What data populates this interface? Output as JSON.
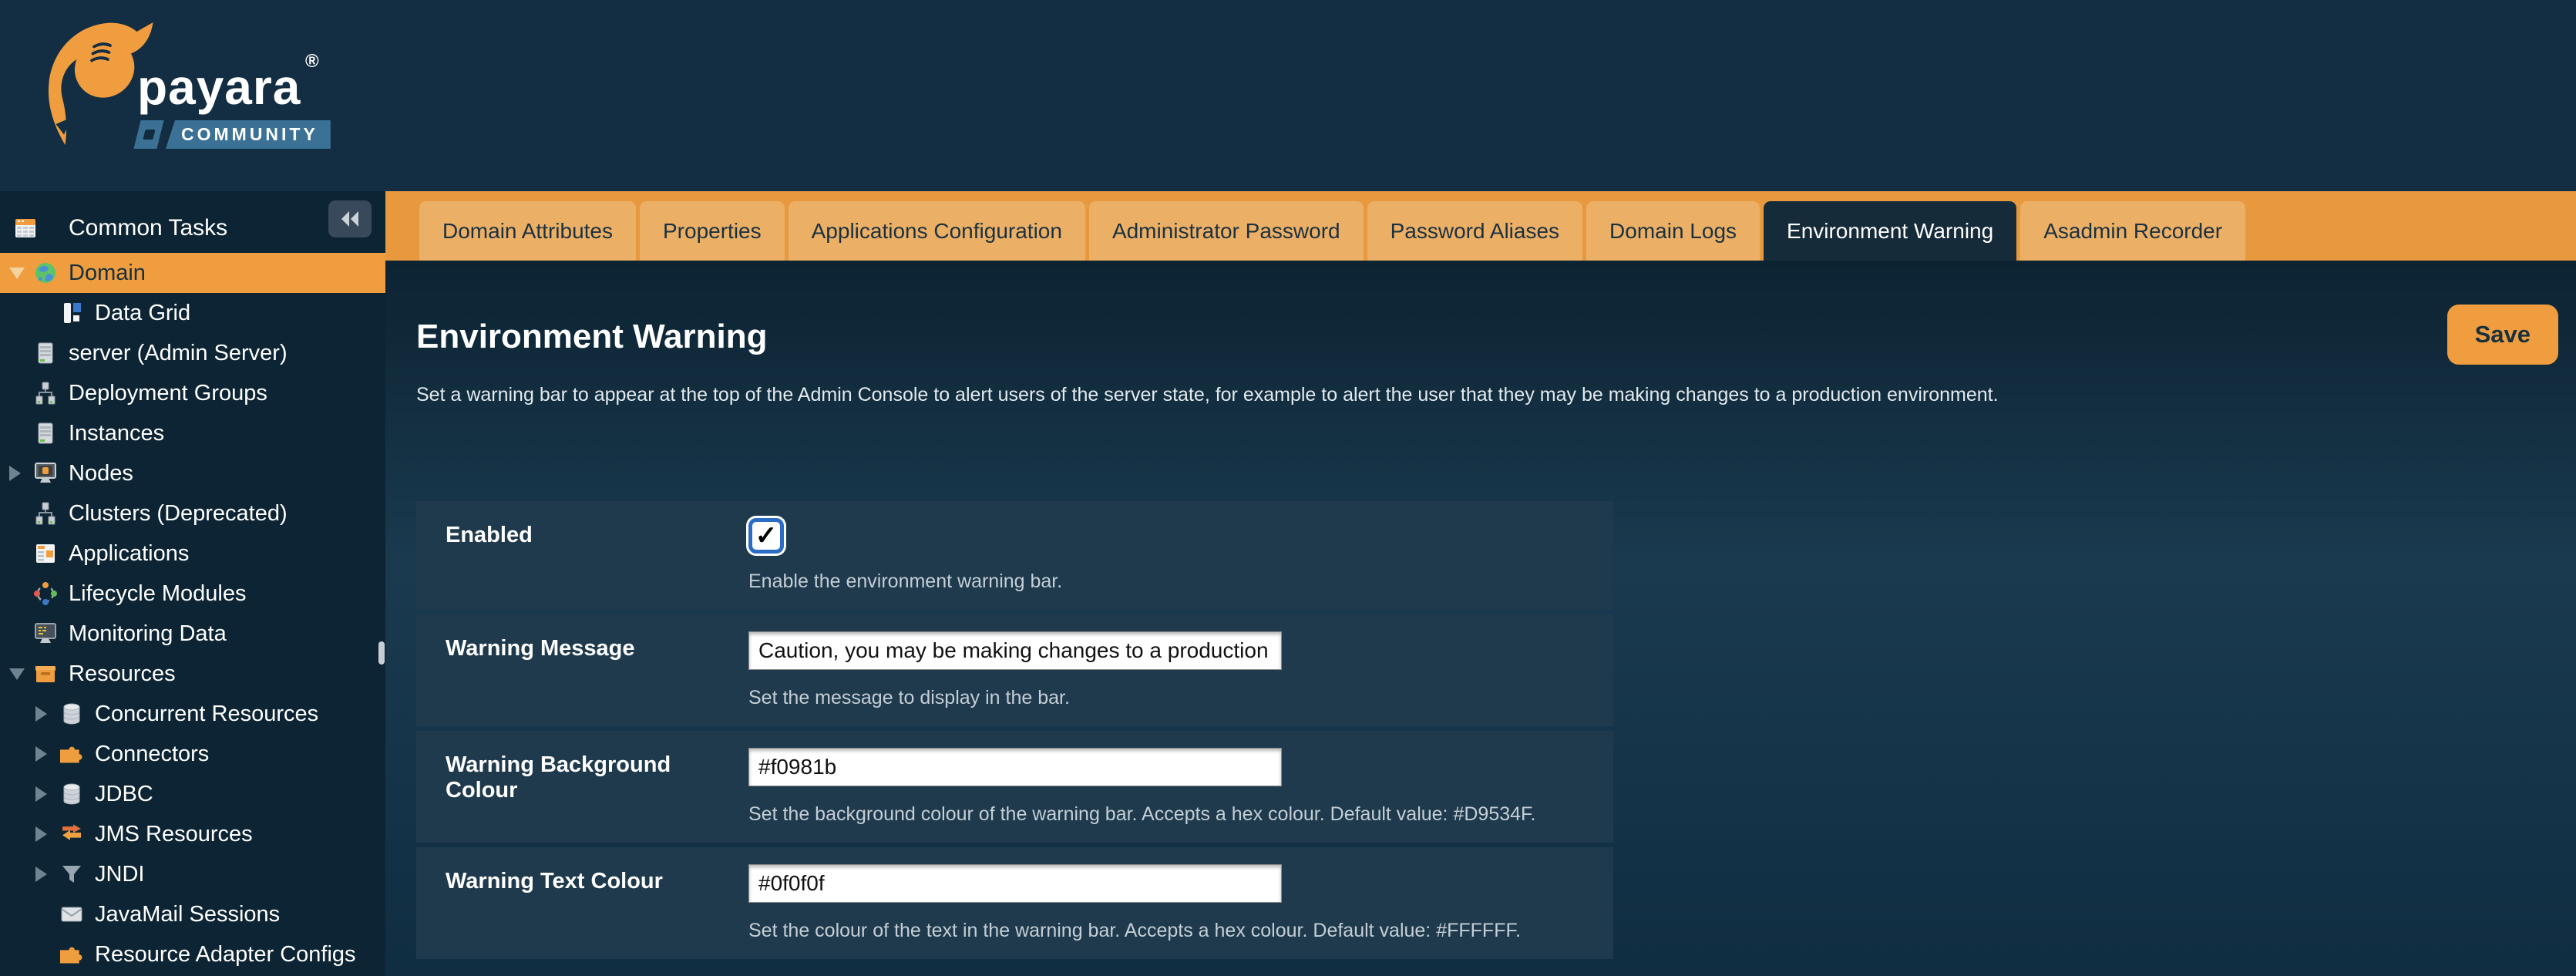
{
  "brand": {
    "wordmark": "payara",
    "registered_mark": "®",
    "badge": "COMMUNITY"
  },
  "sidebar": {
    "header_label": "Common Tasks",
    "items": [
      {
        "label": "Domain",
        "level": 1,
        "expander": "down",
        "icon": "globe-icon",
        "selected": true
      },
      {
        "label": "Data Grid",
        "level": 2,
        "expander": "none",
        "icon": "data-grid-icon",
        "selected": false
      },
      {
        "label": "server (Admin Server)",
        "level": 1,
        "expander": "none",
        "icon": "server-icon",
        "selected": false
      },
      {
        "label": "Deployment Groups",
        "level": 1,
        "expander": "none",
        "icon": "deployment-groups-icon",
        "selected": false
      },
      {
        "label": "Instances",
        "level": 1,
        "expander": "none",
        "icon": "server-icon",
        "selected": false
      },
      {
        "label": "Nodes",
        "level": 1,
        "expander": "right",
        "icon": "node-monitor-icon",
        "selected": false
      },
      {
        "label": "Clusters (Deprecated)",
        "level": 1,
        "expander": "none",
        "icon": "cluster-icon",
        "selected": false
      },
      {
        "label": "Applications",
        "level": 1,
        "expander": "none",
        "icon": "applications-icon",
        "selected": false
      },
      {
        "label": "Lifecycle Modules",
        "level": 1,
        "expander": "none",
        "icon": "lifecycle-icon",
        "selected": false
      },
      {
        "label": "Monitoring Data",
        "level": 1,
        "expander": "none",
        "icon": "monitoring-icon",
        "selected": false
      },
      {
        "label": "Resources",
        "level": 1,
        "expander": "down",
        "icon": "resources-box-icon",
        "selected": false
      },
      {
        "label": "Concurrent Resources",
        "level": 2,
        "expander": "right",
        "icon": "database-icon",
        "selected": false
      },
      {
        "label": "Connectors",
        "level": 2,
        "expander": "right",
        "icon": "connector-puzzle-icon",
        "selected": false
      },
      {
        "label": "JDBC",
        "level": 2,
        "expander": "right",
        "icon": "database-icon",
        "selected": false
      },
      {
        "label": "JMS Resources",
        "level": 2,
        "expander": "right",
        "icon": "jms-arrows-icon",
        "selected": false
      },
      {
        "label": "JNDI",
        "level": 2,
        "expander": "right",
        "icon": "filter-funnel-icon",
        "selected": false
      },
      {
        "label": "JavaMail Sessions",
        "level": 2,
        "expander": "none",
        "icon": "mail-envelope-icon",
        "selected": false
      },
      {
        "label": "Resource Adapter Configs",
        "level": 2,
        "expander": "none",
        "icon": "connector-puzzle-icon",
        "selected": false
      }
    ]
  },
  "tabs": {
    "items": [
      {
        "label": "Domain Attributes",
        "active": false
      },
      {
        "label": "Properties",
        "active": false
      },
      {
        "label": "Applications Configuration",
        "active": false
      },
      {
        "label": "Administrator Password",
        "active": false
      },
      {
        "label": "Password Aliases",
        "active": false
      },
      {
        "label": "Domain Logs",
        "active": false
      },
      {
        "label": "Environment Warning",
        "active": true
      },
      {
        "label": "Asadmin Recorder",
        "active": false
      }
    ]
  },
  "page": {
    "title": "Environment Warning",
    "description": "Set a warning bar to appear at the top of the Admin Console to alert users of the server state, for example to alert the user that they may be making changes to a production environment.",
    "save_label": "Save"
  },
  "form": {
    "checkbox_glyph": "✓",
    "rows": [
      {
        "label": "Enabled",
        "type": "checkbox",
        "checked": true,
        "help": "Enable the environment warning bar."
      },
      {
        "label": "Warning Message",
        "type": "text",
        "value": "Caution, you may be making changes to a production server",
        "help": "Set the message to display in the bar."
      },
      {
        "label": "Warning Background Colour",
        "type": "text",
        "value": "#f0981b",
        "help": "Set the background colour of the warning bar. Accepts a hex colour. Default value: #D9534F."
      },
      {
        "label": "Warning Text Colour",
        "type": "text",
        "value": "#0f0f0f",
        "help": "Set the colour of the text in the warning bar. Accepts a hex colour. Default value: #FFFFFF."
      }
    ]
  },
  "colors": {
    "accent_orange": "#ef9d3e",
    "tab_bar_orange": "#e8993e",
    "tab_inactive": "#ecaf66",
    "tab_active_bg": "#152b39",
    "header_bg": "#132e42",
    "sidebar_bg": "#0c2433",
    "form_row_bg": "#1e3a4c",
    "badge_blue": "#3a7195",
    "checkbox_focus_blue": "#2b6cc4"
  }
}
